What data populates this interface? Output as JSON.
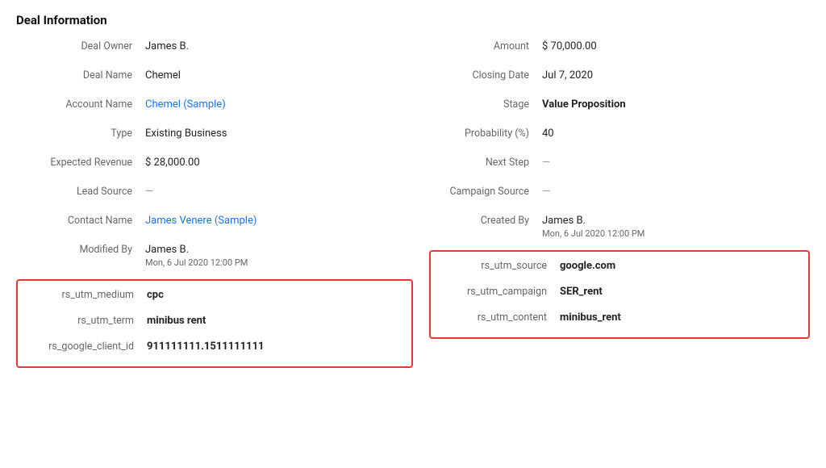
{
  "section": {
    "title": "Deal Information"
  },
  "left": {
    "fields": [
      {
        "label": "Deal Owner",
        "value": "James B.",
        "type": "normal"
      },
      {
        "label": "Deal Name",
        "value": "Chemel",
        "type": "normal"
      },
      {
        "label": "Account Name",
        "value": "Chemel (Sample)",
        "type": "link"
      },
      {
        "label": "Type",
        "value": "Existing Business",
        "type": "normal"
      },
      {
        "label": "Expected Revenue",
        "value": "$ 28,000.00",
        "type": "normal"
      },
      {
        "label": "Lead Source",
        "value": "—",
        "type": "dash"
      },
      {
        "label": "Contact Name",
        "value": "James Venere (Sample)",
        "type": "link"
      },
      {
        "label": "Modified By",
        "value": "James B.",
        "sub": "Mon, 6 Jul 2020 12:00 PM",
        "type": "multiline"
      }
    ],
    "box": {
      "fields": [
        {
          "label": "rs_utm_medium",
          "value": "cpc"
        },
        {
          "label": "rs_utm_term",
          "value": "minibus rent"
        },
        {
          "label": "rs_google_client_id",
          "value": "911111111.1511111111"
        }
      ]
    }
  },
  "right": {
    "fields": [
      {
        "label": "Amount",
        "value": "$ 70,000.00",
        "type": "normal"
      },
      {
        "label": "Closing Date",
        "value": "Jul 7, 2020",
        "type": "normal"
      },
      {
        "label": "Stage",
        "value": "Value Proposition",
        "type": "bold"
      },
      {
        "label": "Probability (%)",
        "value": "40",
        "type": "normal"
      },
      {
        "label": "Next Step",
        "value": "—",
        "type": "dash"
      },
      {
        "label": "Campaign Source",
        "value": "—",
        "type": "dash"
      },
      {
        "label": "Created By",
        "value": "James B.",
        "sub": "Mon, 6 Jul 2020 12:00 PM",
        "type": "multiline"
      }
    ],
    "box": {
      "fields": [
        {
          "label": "rs_utm_source",
          "value": "google.com"
        },
        {
          "label": "rs_utm_campaign",
          "value": "SER_rent"
        },
        {
          "label": "rs_utm_content",
          "value": "minibus_rent"
        }
      ]
    }
  }
}
